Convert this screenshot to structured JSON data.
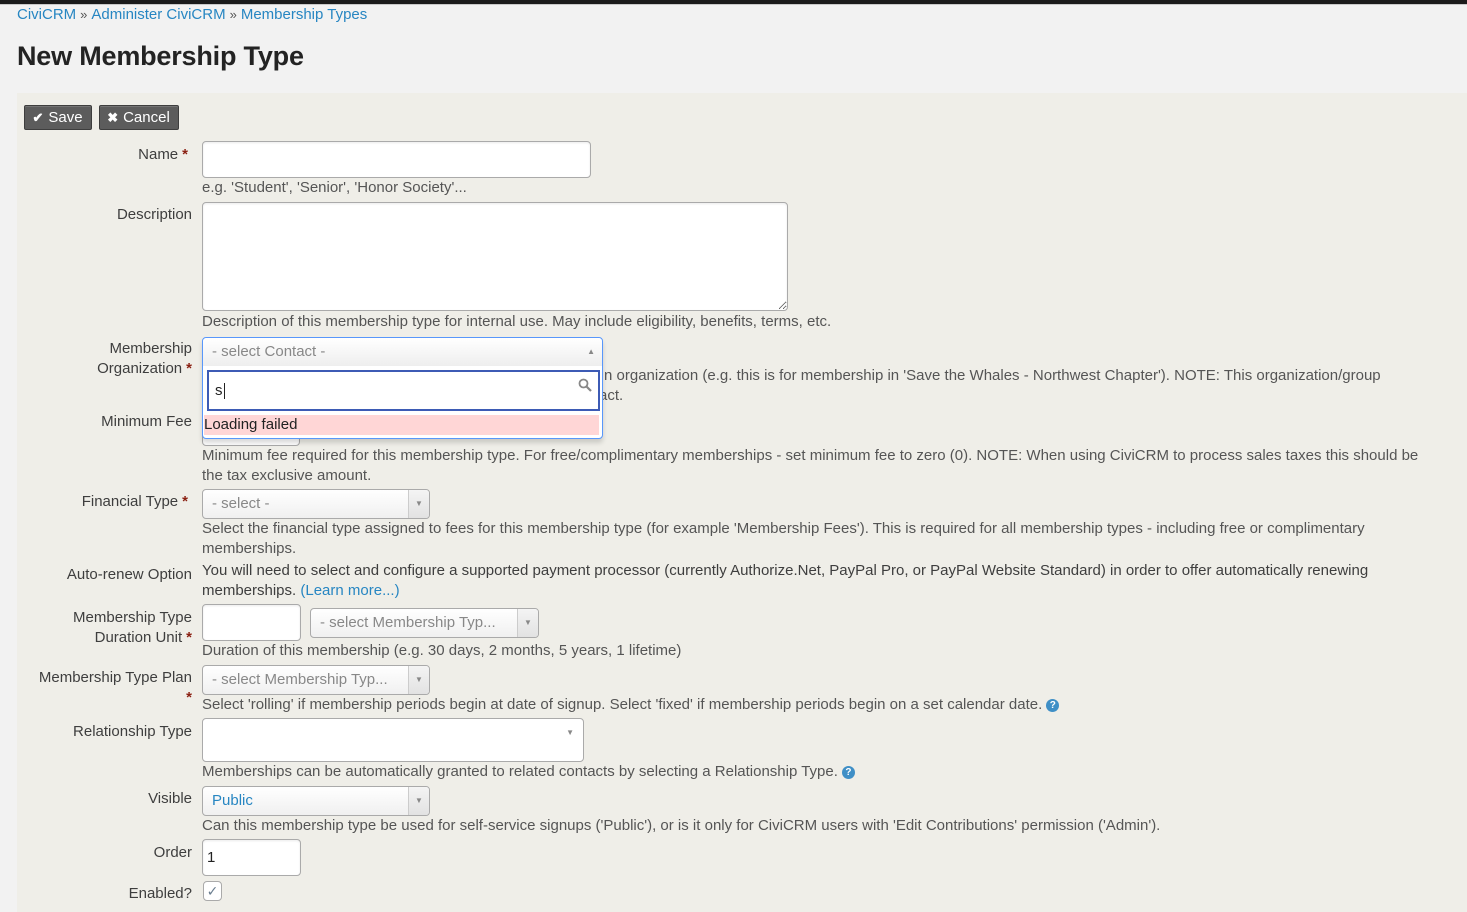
{
  "breadcrumb": {
    "items": [
      "CiviCRM",
      "Administer CiviCRM",
      "Membership Types"
    ],
    "separator": "»"
  },
  "page_title": "New Membership Type",
  "toolbar": {
    "save_label": "Save",
    "save_icon": "✔",
    "cancel_label": "Cancel",
    "cancel_icon": "✖"
  },
  "required_marker": "*",
  "form": {
    "name": {
      "label": "Name",
      "value": "",
      "help": "e.g. 'Student', 'Senior', 'Honor Society'..."
    },
    "description": {
      "label": "Description",
      "value": "",
      "help": "Description of this membership type for internal use. May include eligibility, benefits, terms, etc."
    },
    "membership_org": {
      "label_line1": "Membership",
      "label_line2": "Organization",
      "placeholder": "- select Contact -",
      "search_value": "s",
      "error_message": "Loading failed",
      "help_line1_visible": "n organization (e.g. this is for membership in 'Save the Whales - Northwest Chapter'). NOTE: This organization/group",
      "help_line2_visible": "act."
    },
    "minimum_fee": {
      "label": "Minimum Fee",
      "help": "Minimum fee required for this membership type. For free/complimentary memberships - set minimum fee to zero (0). NOTE: When using CiviCRM to process sales taxes this should be the tax exclusive amount."
    },
    "financial_type": {
      "label": "Financial Type",
      "placeholder": "- select -",
      "help": "Select the financial type assigned to fees for this membership type (for example 'Membership Fees'). This is required for all membership types - including free or complimentary memberships."
    },
    "auto_renew": {
      "label": "Auto-renew Option",
      "help": "You will need to select and configure a supported payment processor (currently Authorize.Net, PayPal Pro, or PayPal Website Standard) in order to offer automatically renewing memberships.",
      "learn_more": "(Learn more...)"
    },
    "duration": {
      "label_line1": "Membership Type",
      "label_line2": "Duration Unit",
      "interval_value": "",
      "unit_placeholder": "- select Membership Typ...",
      "help": "Duration of this membership (e.g. 30 days, 2 months, 5 years, 1 lifetime)"
    },
    "plan": {
      "label": "Membership Type Plan",
      "placeholder": "- select Membership Typ...",
      "help": "Select 'rolling' if membership periods begin at date of signup. Select 'fixed' if membership periods begin on a set calendar date."
    },
    "relationship_type": {
      "label": "Relationship Type",
      "value": "",
      "help": "Memberships can be automatically granted to related contacts by selecting a Relationship Type."
    },
    "visible": {
      "label": "Visible",
      "value": "Public",
      "help": "Can this membership type be used for self-service signups ('Public'), or is it only for CiviCRM users with 'Edit Contributions' permission ('Admin')."
    },
    "order": {
      "label": "Order",
      "value": "1"
    },
    "enabled": {
      "label": "Enabled?",
      "checked": true,
      "check_glyph": "✓"
    }
  },
  "icons": {
    "dropdown_arrow": "▼",
    "dropdown_up": "▲",
    "search": "⚲",
    "help": "?"
  },
  "colors": {
    "link": "#2786c2",
    "required": "#8a1f11",
    "panel_bg": "#efeee8",
    "error_bg": "#ffd6d6",
    "focus_border": "#3d5bb5",
    "button_bg": "#5c5c5c"
  }
}
